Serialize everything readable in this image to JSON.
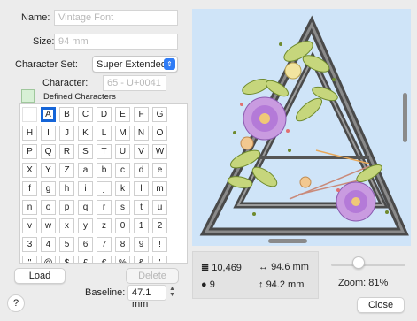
{
  "form": {
    "name_label": "Name:",
    "name_placeholder": "Vintage Font",
    "size_label": "Size:",
    "size_placeholder": "94 mm",
    "charset_label": "Character Set:",
    "charset_value": "Super Extended",
    "character_label": "Character:",
    "character_placeholder": "65 - U+0041",
    "defined_label": "Defined Characters",
    "swatch_color": "#d7f0d5"
  },
  "grid": {
    "rows": [
      [
        "",
        "A",
        "B",
        "C",
        "D",
        "E",
        "F",
        "G"
      ],
      [
        "H",
        "I",
        "J",
        "K",
        "L",
        "M",
        "N",
        "O"
      ],
      [
        "P",
        "Q",
        "R",
        "S",
        "T",
        "U",
        "V",
        "W"
      ],
      [
        "X",
        "Y",
        "Z",
        "a",
        "b",
        "c",
        "d",
        "e"
      ],
      [
        "f",
        "g",
        "h",
        "i",
        "j",
        "k",
        "l",
        "m"
      ],
      [
        "n",
        "o",
        "p",
        "q",
        "r",
        "s",
        "t",
        "u"
      ],
      [
        "v",
        "w",
        "x",
        "y",
        "z",
        "0",
        "1",
        "2"
      ],
      [
        "3",
        "4",
        "5",
        "6",
        "7",
        "8",
        "9",
        "!"
      ],
      [
        "\"",
        "@",
        "$",
        "£",
        "€",
        "%",
        "&",
        "'"
      ]
    ],
    "selected": "A"
  },
  "buttons": {
    "load": "Load",
    "delete": "Delete",
    "close": "Close",
    "help": "?"
  },
  "baseline": {
    "label": "Baseline:",
    "value": "47.1 mm"
  },
  "info": {
    "stitches": "10,469",
    "width": "94.6 mm",
    "colors": "9",
    "height": "94.2 mm"
  },
  "zoom": {
    "label": "Zoom: 81%",
    "level_fraction": 0.35
  },
  "colors": {
    "accent": "#1565d8",
    "preview_bg": "#cfe4f8"
  }
}
